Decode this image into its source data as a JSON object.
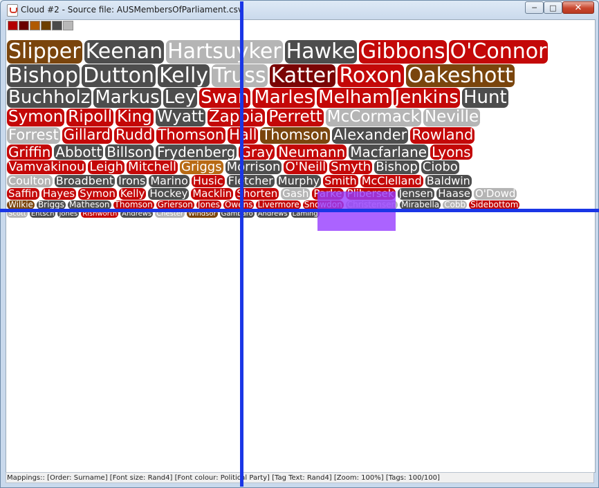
{
  "window": {
    "title": "Cloud #2 - Source file: AUSMembersOfParliament.csv",
    "minimize_glyph": "─",
    "maximize_glyph": "□",
    "close_glyph": "✕"
  },
  "palette": [
    "#b30000",
    "#6b0000",
    "#b05a00",
    "#6e4000",
    "#4a4a4a",
    "#b8b8b8"
  ],
  "colors": {
    "red": "#c40808",
    "darkred": "#7a0505",
    "brown": "#7a450d",
    "orange": "#b86a14",
    "dark": "#4d4d4d",
    "light": "#b5b5b5",
    "crosshair": "#1a36e6",
    "selection": "#9b3cff"
  },
  "cloud": {
    "rows": [
      {
        "size": 30,
        "tags": [
          {
            "text": "Slipper",
            "c": "brown"
          },
          {
            "text": "Keenan",
            "c": "dark"
          },
          {
            "text": "Hartsuyker",
            "c": "light"
          },
          {
            "text": "Hawke",
            "c": "dark"
          },
          {
            "text": "Gibbons",
            "c": "red"
          },
          {
            "text": "O'Connor",
            "c": "red"
          }
        ]
      },
      {
        "size": 30,
        "tags": [
          {
            "text": "Bishop",
            "c": "dark"
          },
          {
            "text": "Dutton",
            "c": "dark"
          },
          {
            "text": "Kelly",
            "c": "dark"
          },
          {
            "text": "Truss",
            "c": "light"
          },
          {
            "text": "Katter",
            "c": "darkred"
          },
          {
            "text": "Roxon",
            "c": "red"
          },
          {
            "text": "Oakeshott",
            "c": "brown"
          }
        ]
      },
      {
        "size": 26,
        "tags": [
          {
            "text": "Buchholz",
            "c": "dark"
          },
          {
            "text": "Markus",
            "c": "dark"
          },
          {
            "text": "Ley",
            "c": "dark"
          },
          {
            "text": "Swan",
            "c": "red"
          },
          {
            "text": "Marles",
            "c": "red"
          },
          {
            "text": "Melham",
            "c": "red"
          },
          {
            "text": "Jenkins",
            "c": "red"
          },
          {
            "text": "Hunt",
            "c": "dark"
          }
        ]
      },
      {
        "size": 23,
        "tags": [
          {
            "text": "Symon",
            "c": "red"
          },
          {
            "text": "Ripoll",
            "c": "red"
          },
          {
            "text": "King",
            "c": "red"
          },
          {
            "text": "Wyatt",
            "c": "dark"
          },
          {
            "text": "Zappia",
            "c": "red"
          },
          {
            "text": "Perrett",
            "c": "red"
          },
          {
            "text": "McCormack",
            "c": "light"
          },
          {
            "text": "Neville",
            "c": "light"
          }
        ]
      },
      {
        "size": 21,
        "tags": [
          {
            "text": "Forrest",
            "c": "light"
          },
          {
            "text": "Gillard",
            "c": "red"
          },
          {
            "text": "Rudd",
            "c": "red"
          },
          {
            "text": "Thomson",
            "c": "red"
          },
          {
            "text": "Hall",
            "c": "red"
          },
          {
            "text": "Thomson",
            "c": "brown"
          },
          {
            "text": "Alexander",
            "c": "dark"
          },
          {
            "text": "Rowland",
            "c": "red"
          }
        ]
      },
      {
        "size": 20,
        "tags": [
          {
            "text": "Griffin",
            "c": "red"
          },
          {
            "text": "Abbott",
            "c": "dark"
          },
          {
            "text": "Billson",
            "c": "dark"
          },
          {
            "text": "Frydenberg",
            "c": "dark"
          },
          {
            "text": "Gray",
            "c": "red"
          },
          {
            "text": "Neumann",
            "c": "red"
          },
          {
            "text": "Macfarlane",
            "c": "dark"
          },
          {
            "text": "Lyons",
            "c": "red"
          }
        ]
      },
      {
        "size": 18,
        "tags": [
          {
            "text": "Vamvakinou",
            "c": "red"
          },
          {
            "text": "Leigh",
            "c": "red"
          },
          {
            "text": "Mitchell",
            "c": "red"
          },
          {
            "text": "Griggs",
            "c": "orange"
          },
          {
            "text": "Morrison",
            "c": "dark"
          },
          {
            "text": "O'Neill",
            "c": "red"
          },
          {
            "text": "Smyth",
            "c": "red"
          },
          {
            "text": "Bishop",
            "c": "dark"
          },
          {
            "text": "Ciobo",
            "c": "dark"
          }
        ]
      },
      {
        "size": 16,
        "tags": [
          {
            "text": "Coulton",
            "c": "light"
          },
          {
            "text": "Broadbent",
            "c": "dark"
          },
          {
            "text": "Irons",
            "c": "dark"
          },
          {
            "text": "Marino",
            "c": "dark"
          },
          {
            "text": "Husic",
            "c": "red"
          },
          {
            "text": "Fletcher",
            "c": "dark"
          },
          {
            "text": "Murphy",
            "c": "dark"
          },
          {
            "text": "Smith",
            "c": "red"
          },
          {
            "text": "McClelland",
            "c": "red"
          },
          {
            "text": "Baldwin",
            "c": "dark"
          }
        ]
      },
      {
        "size": 15,
        "tags": [
          {
            "text": "Saffin",
            "c": "red"
          },
          {
            "text": "Hayes",
            "c": "red"
          },
          {
            "text": "Symon",
            "c": "red"
          },
          {
            "text": "Kelly",
            "c": "red"
          },
          {
            "text": "Hockey",
            "c": "dark"
          },
          {
            "text": "Macklin",
            "c": "red"
          },
          {
            "text": "Shorten",
            "c": "red"
          },
          {
            "text": "Gash",
            "c": "light"
          },
          {
            "text": "Parke",
            "c": "red"
          },
          {
            "text": "Plibersek",
            "c": "red"
          },
          {
            "text": "Jensen",
            "c": "dark"
          },
          {
            "text": "Haase",
            "c": "dark"
          },
          {
            "text": "O'Dowd",
            "c": "light"
          }
        ]
      },
      {
        "size": 12,
        "tags": [
          {
            "text": "Wilkie",
            "c": "brown"
          },
          {
            "text": "Briggs",
            "c": "dark"
          },
          {
            "text": "Matheson",
            "c": "dark"
          },
          {
            "text": "Thomson",
            "c": "red"
          },
          {
            "text": "Grierson",
            "c": "red"
          },
          {
            "text": "Jones",
            "c": "red"
          },
          {
            "text": "Owens",
            "c": "red"
          },
          {
            "text": "Livermore",
            "c": "red"
          },
          {
            "text": "Snowdon",
            "c": "red"
          },
          {
            "text": "Christensen",
            "c": "light"
          },
          {
            "text": "Mirabella",
            "c": "dark"
          },
          {
            "text": "Cobb",
            "c": "light"
          },
          {
            "text": "Sidebottom",
            "c": "red"
          }
        ]
      },
      {
        "size": 10,
        "tags": [
          {
            "text": "Scott",
            "c": "light"
          },
          {
            "text": "Entsch",
            "c": "dark"
          },
          {
            "text": "Jones",
            "c": "dark"
          },
          {
            "text": "Rishworth",
            "c": "red"
          },
          {
            "text": "Andrews",
            "c": "dark"
          },
          {
            "text": "Chester",
            "c": "light"
          },
          {
            "text": "Windsor",
            "c": "brown"
          },
          {
            "text": "Gambaro",
            "c": "dark"
          },
          {
            "text": "Andrews",
            "c": "dark"
          },
          {
            "text": "Laming",
            "c": "dark"
          }
        ]
      }
    ]
  },
  "status": {
    "text": "Mappings:: [Order: Surname]  [Font size: Rand4]  [Font colour: Political Party]  [Tag Text: Rand4]  [Zoom: 100%]  [Tags: 100/100]"
  }
}
